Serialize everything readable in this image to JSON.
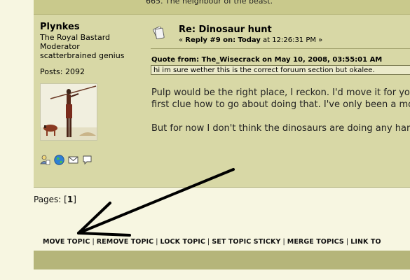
{
  "signature": {
    "text": "665. The neighbour of the beast."
  },
  "poster": {
    "name": "Plynkes",
    "titles": [
      "The Royal Bastard",
      "Moderator",
      "scatterbrained genius"
    ],
    "posts": "Posts: 2092",
    "profile_icons": [
      "profile-icon",
      "website-globe-icon",
      "email-icon",
      "personal-message-icon"
    ]
  },
  "post": {
    "title": "Re: Dinosaur hunt",
    "meta_prefix": "« ",
    "meta_reply": "Reply #9 on:",
    "meta_today": "Today",
    "meta_time": " at 12:26:31 PM »",
    "quote_header": "Quote from: The_Wisecrack on May 10, 2008, 03:55:01 AM",
    "quote_text": "hi im sure wether this is the correct foruum section but okalee.",
    "body_paragraphs": [
      "Pulp would be the right place, I reckon. I'd move it for you,",
      "first clue how to go about doing that. I've only been a mod",
      "But for now I don't think the dinosaurs are doing any harm"
    ]
  },
  "pages": {
    "label": "Pages: ",
    "open": "[",
    "current": "1",
    "close": "]"
  },
  "moderation": {
    "move": "MOVE TOPIC",
    "remove": "REMOVE TOPIC",
    "lock": "LOCK TOPIC",
    "sticky": "SET TOPIC STICKY",
    "merge": "MERGE TOPICS",
    "link": "LINK TO",
    "separator": "|"
  },
  "colors": {
    "page_bg": "#f7f6e1",
    "post_bg": "#d8d8a6",
    "header_bar": "#c9c98c",
    "bottom_bar": "#b5b57a",
    "quote_bg": "#ebeaca"
  }
}
